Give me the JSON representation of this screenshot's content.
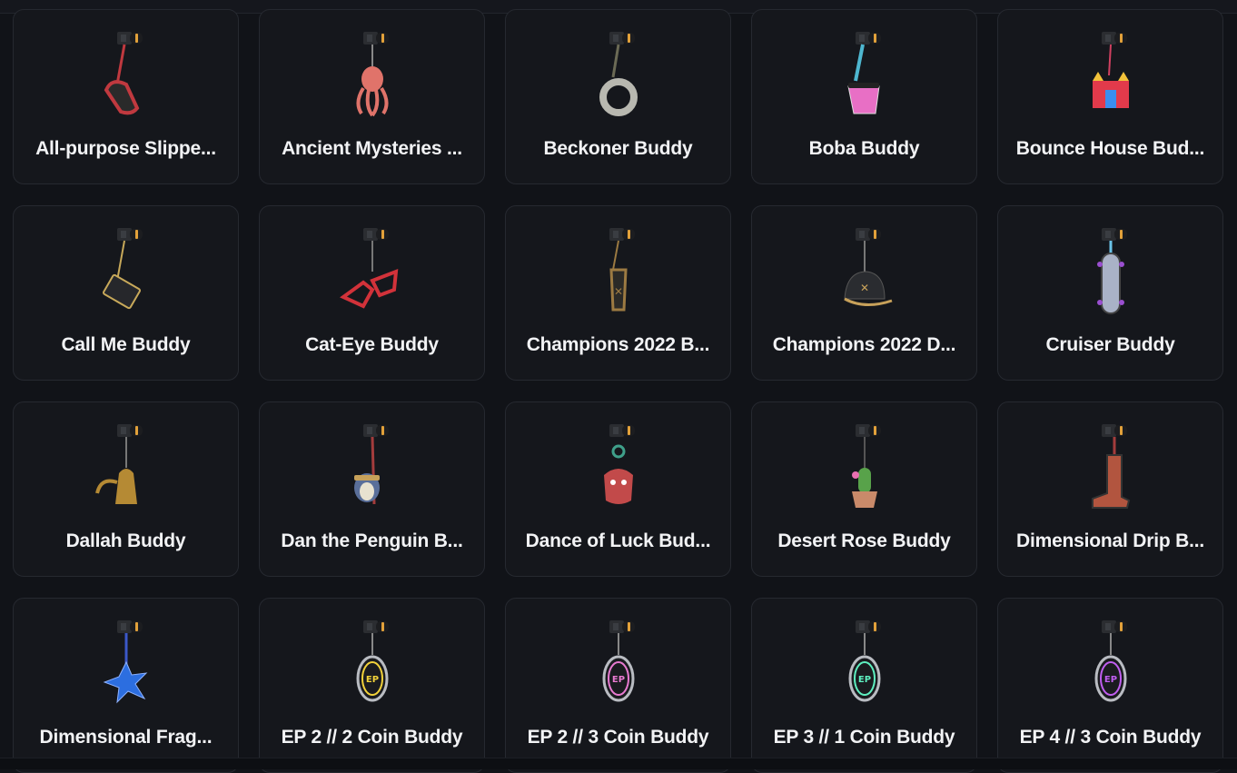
{
  "items": [
    {
      "label": "All-purpose Slippe...",
      "icon": "slipper-buddy-icon",
      "color": "#c0393f"
    },
    {
      "label": "Ancient Mysteries ...",
      "icon": "octopus-buddy-icon",
      "color": "#e0736a"
    },
    {
      "label": "Beckoner Buddy",
      "icon": "ring-buddy-icon",
      "color": "#b8b8b0"
    },
    {
      "label": "Boba Buddy",
      "icon": "boba-buddy-icon",
      "color": "#e86fc5"
    },
    {
      "label": "Bounce House Bud...",
      "icon": "bounce-house-buddy-icon",
      "color": "#e23a4b"
    },
    {
      "label": "Call Me Buddy",
      "icon": "card-buddy-icon",
      "color": "#c8a95a"
    },
    {
      "label": "Cat-Eye Buddy",
      "icon": "glasses-buddy-icon",
      "color": "#d2323a"
    },
    {
      "label": "Champions 2022 B...",
      "icon": "champions-charm-icon",
      "color": "#9c7a42"
    },
    {
      "label": "Champions 2022 D...",
      "icon": "cap-buddy-icon",
      "color": "#2a2c30"
    },
    {
      "label": "Cruiser Buddy",
      "icon": "skateboard-buddy-icon",
      "color": "#a9b2c6"
    },
    {
      "label": "Dallah Buddy",
      "icon": "dallah-buddy-icon",
      "color": "#b58a34"
    },
    {
      "label": "Dan the Penguin B...",
      "icon": "penguin-buddy-icon",
      "color": "#5a6f9a"
    },
    {
      "label": "Dance of Luck Bud...",
      "icon": "lion-buddy-icon",
      "color": "#c24a4a"
    },
    {
      "label": "Desert Rose Buddy",
      "icon": "cactus-buddy-icon",
      "color": "#58a24a"
    },
    {
      "label": "Dimensional Drip B...",
      "icon": "boot-buddy-icon",
      "color": "#b2553f"
    },
    {
      "label": "Dimensional Frag...",
      "icon": "crystal-buddy-icon",
      "color": "#2c6ee0"
    },
    {
      "label": "EP 2 // 2 Coin Buddy",
      "icon": "coin-buddy-icon",
      "color": "#f2d23a"
    },
    {
      "label": "EP 2 // 3 Coin Buddy",
      "icon": "coin-buddy-icon",
      "color": "#e87ad0"
    },
    {
      "label": "EP 3 // 1 Coin Buddy",
      "icon": "coin-buddy-icon",
      "color": "#5ef0c0"
    },
    {
      "label": "EP 4 // 3 Coin Buddy",
      "icon": "coin-buddy-icon",
      "color": "#c05ef0"
    }
  ]
}
